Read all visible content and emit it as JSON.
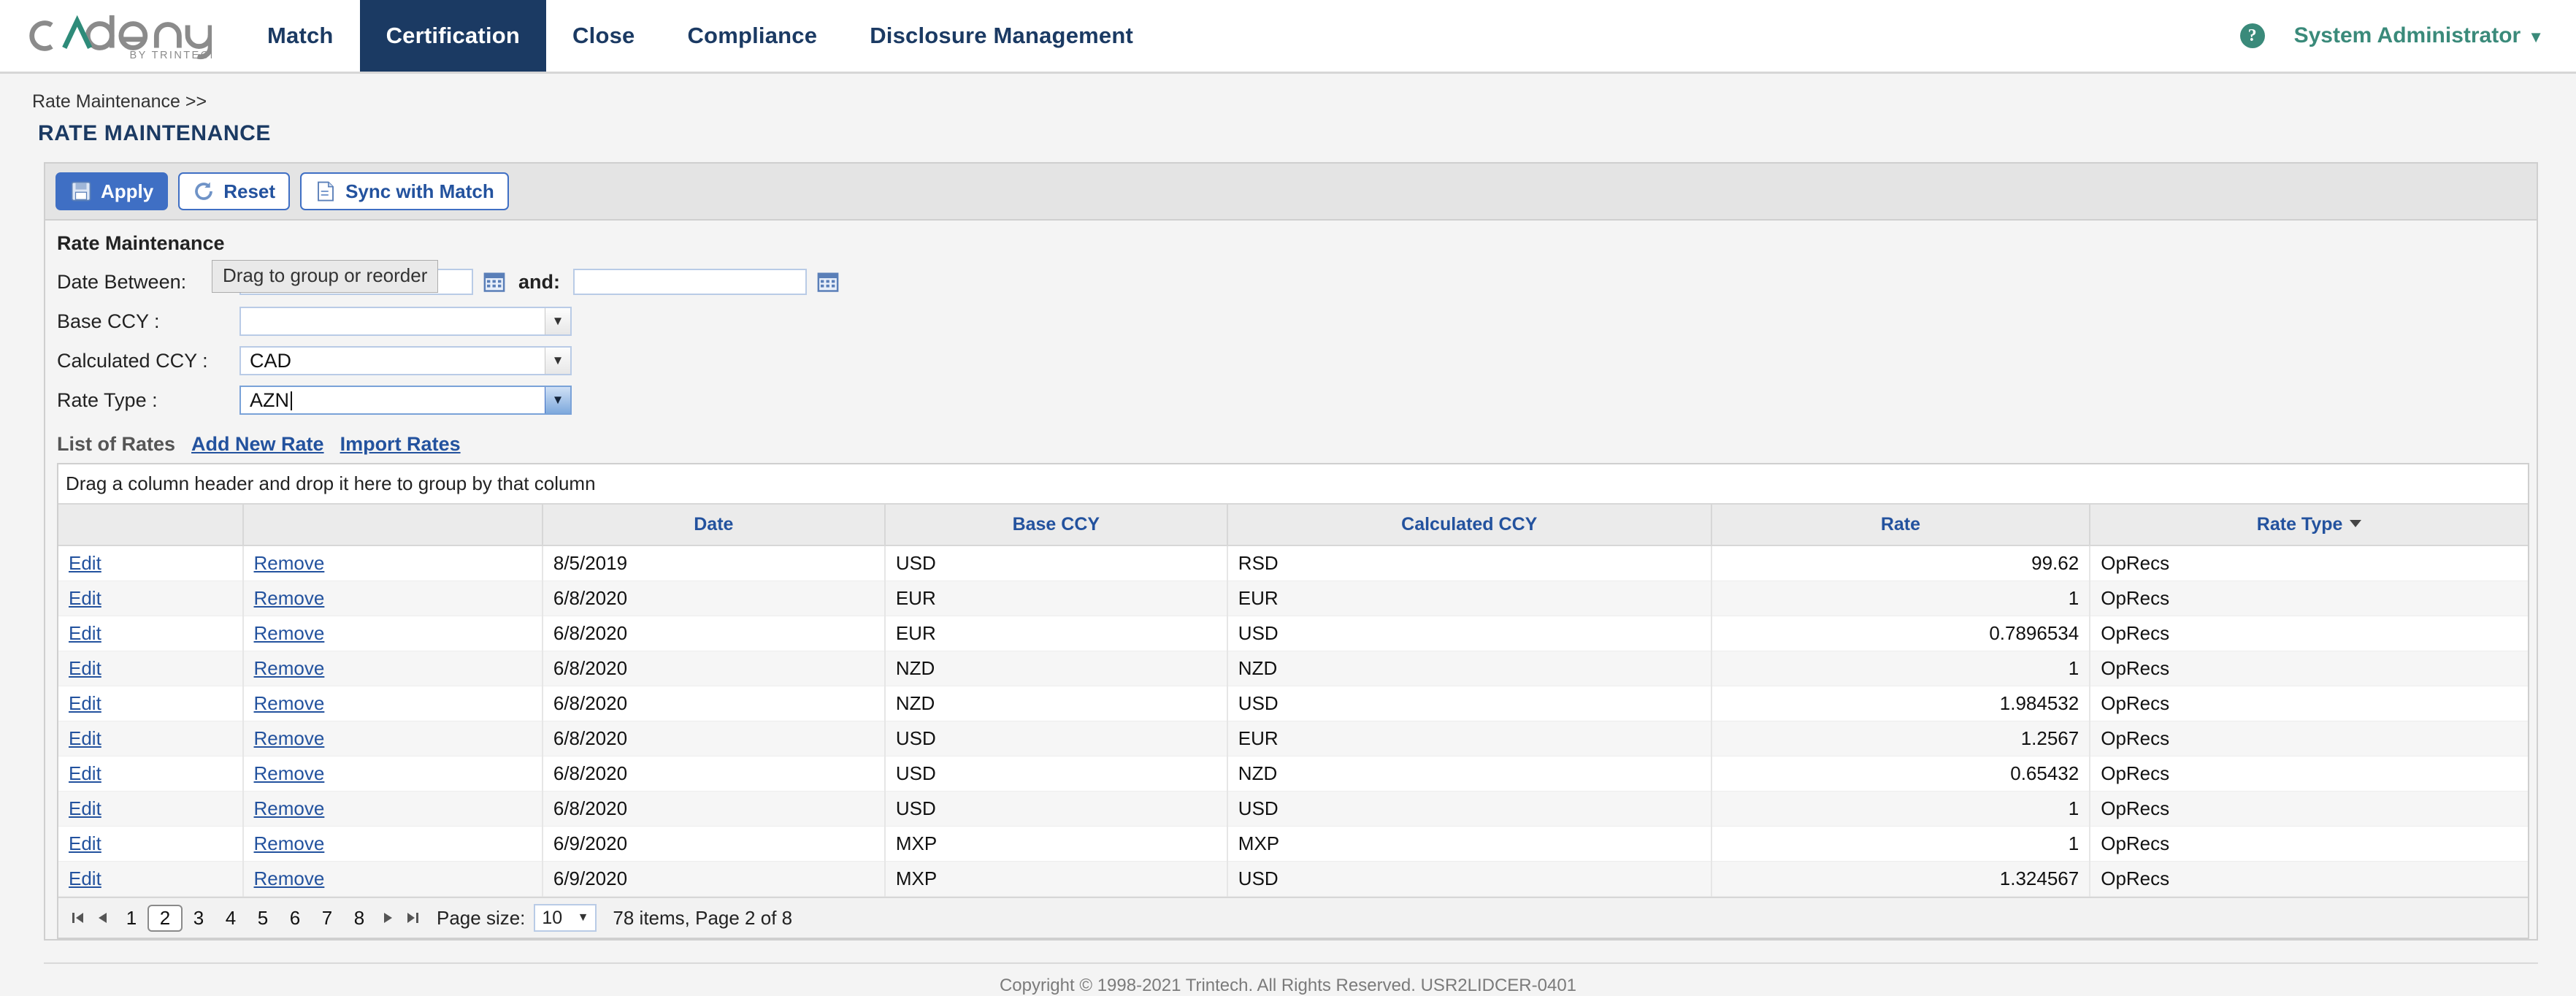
{
  "header": {
    "logo_text": "cadency",
    "logo_sub": "BY TRINTECH",
    "nav": [
      {
        "label": "Match",
        "active": false
      },
      {
        "label": "Certification",
        "active": true
      },
      {
        "label": "Close",
        "active": false
      },
      {
        "label": "Compliance",
        "active": false
      },
      {
        "label": "Disclosure Management",
        "active": false
      }
    ],
    "help_glyph": "?",
    "user": "System Administrator",
    "user_caret": "▼"
  },
  "breadcrumb": "Rate Maintenance >>",
  "page_title": "RATE MAINTENANCE",
  "toolbar": {
    "apply_label": "Apply",
    "reset_label": "Reset",
    "sync_label": "Sync with Match"
  },
  "form": {
    "section_title": "Rate Maintenance",
    "date_between_label": "Date Between:",
    "date_from_value": "",
    "date_from_placeholder": "",
    "and_label": "and:",
    "date_to_value": "",
    "date_to_placeholder": "",
    "base_ccy_label": "Base CCY :",
    "base_ccy_value": "",
    "calculated_ccy_label": "Calculated CCY :",
    "calculated_ccy_value": "CAD",
    "rate_type_label": "Rate Type :",
    "rate_type_value": "AZN",
    "combo_caret": "▼",
    "tooltip": "Drag to group or reorder"
  },
  "list": {
    "title": "List of Rates",
    "add_new_label": "Add New Rate",
    "import_label": "Import Rates",
    "group_hint": "Drag a column header and drop it here to group by that column",
    "edit_label": "Edit",
    "remove_label": "Remove",
    "columns": [
      {
        "key": "edit",
        "label": ""
      },
      {
        "key": "remove",
        "label": ""
      },
      {
        "key": "date",
        "label": "Date"
      },
      {
        "key": "base_ccy",
        "label": "Base CCY"
      },
      {
        "key": "calculated_ccy",
        "label": "Calculated CCY"
      },
      {
        "key": "rate",
        "label": "Rate"
      },
      {
        "key": "rate_type",
        "label": "Rate Type",
        "sorted": "desc"
      }
    ],
    "rows": [
      {
        "date": "8/5/2019",
        "base_ccy": "USD",
        "calculated_ccy": "RSD",
        "rate": "99.62",
        "rate_type": "OpRecs"
      },
      {
        "date": "6/8/2020",
        "base_ccy": "EUR",
        "calculated_ccy": "EUR",
        "rate": "1",
        "rate_type": "OpRecs"
      },
      {
        "date": "6/8/2020",
        "base_ccy": "EUR",
        "calculated_ccy": "USD",
        "rate": "0.7896534",
        "rate_type": "OpRecs"
      },
      {
        "date": "6/8/2020",
        "base_ccy": "NZD",
        "calculated_ccy": "NZD",
        "rate": "1",
        "rate_type": "OpRecs"
      },
      {
        "date": "6/8/2020",
        "base_ccy": "NZD",
        "calculated_ccy": "USD",
        "rate": "1.984532",
        "rate_type": "OpRecs"
      },
      {
        "date": "6/8/2020",
        "base_ccy": "USD",
        "calculated_ccy": "EUR",
        "rate": "1.2567",
        "rate_type": "OpRecs"
      },
      {
        "date": "6/8/2020",
        "base_ccy": "USD",
        "calculated_ccy": "NZD",
        "rate": "0.65432",
        "rate_type": "OpRecs"
      },
      {
        "date": "6/8/2020",
        "base_ccy": "USD",
        "calculated_ccy": "USD",
        "rate": "1",
        "rate_type": "OpRecs"
      },
      {
        "date": "6/9/2020",
        "base_ccy": "MXP",
        "calculated_ccy": "MXP",
        "rate": "1",
        "rate_type": "OpRecs"
      },
      {
        "date": "6/9/2020",
        "base_ccy": "MXP",
        "calculated_ccy": "USD",
        "rate": "1.324567",
        "rate_type": "OpRecs"
      }
    ]
  },
  "pager": {
    "first_glyph": "◀",
    "prev_glyph": "◀",
    "next_glyph": "▶",
    "last_glyph": "▶",
    "pages": [
      "1",
      "2",
      "3",
      "4",
      "5",
      "6",
      "7",
      "8"
    ],
    "current_page": "2",
    "page_size_label": "Page size:",
    "page_size_value": "10",
    "page_size_caret": "▼",
    "status": "78 items, Page 2 of 8"
  },
  "footer": {
    "copyright": "Copyright © 1998-2021 Trintech. All Rights Reserved. USR2LIDCER-0401"
  },
  "colors": {
    "nav_active_bg": "#1b3a63",
    "nav_text": "#1b3a63",
    "accent_teal": "#3a8a7a",
    "link_blue": "#23529e",
    "primary_button": "#3f6fc4"
  }
}
